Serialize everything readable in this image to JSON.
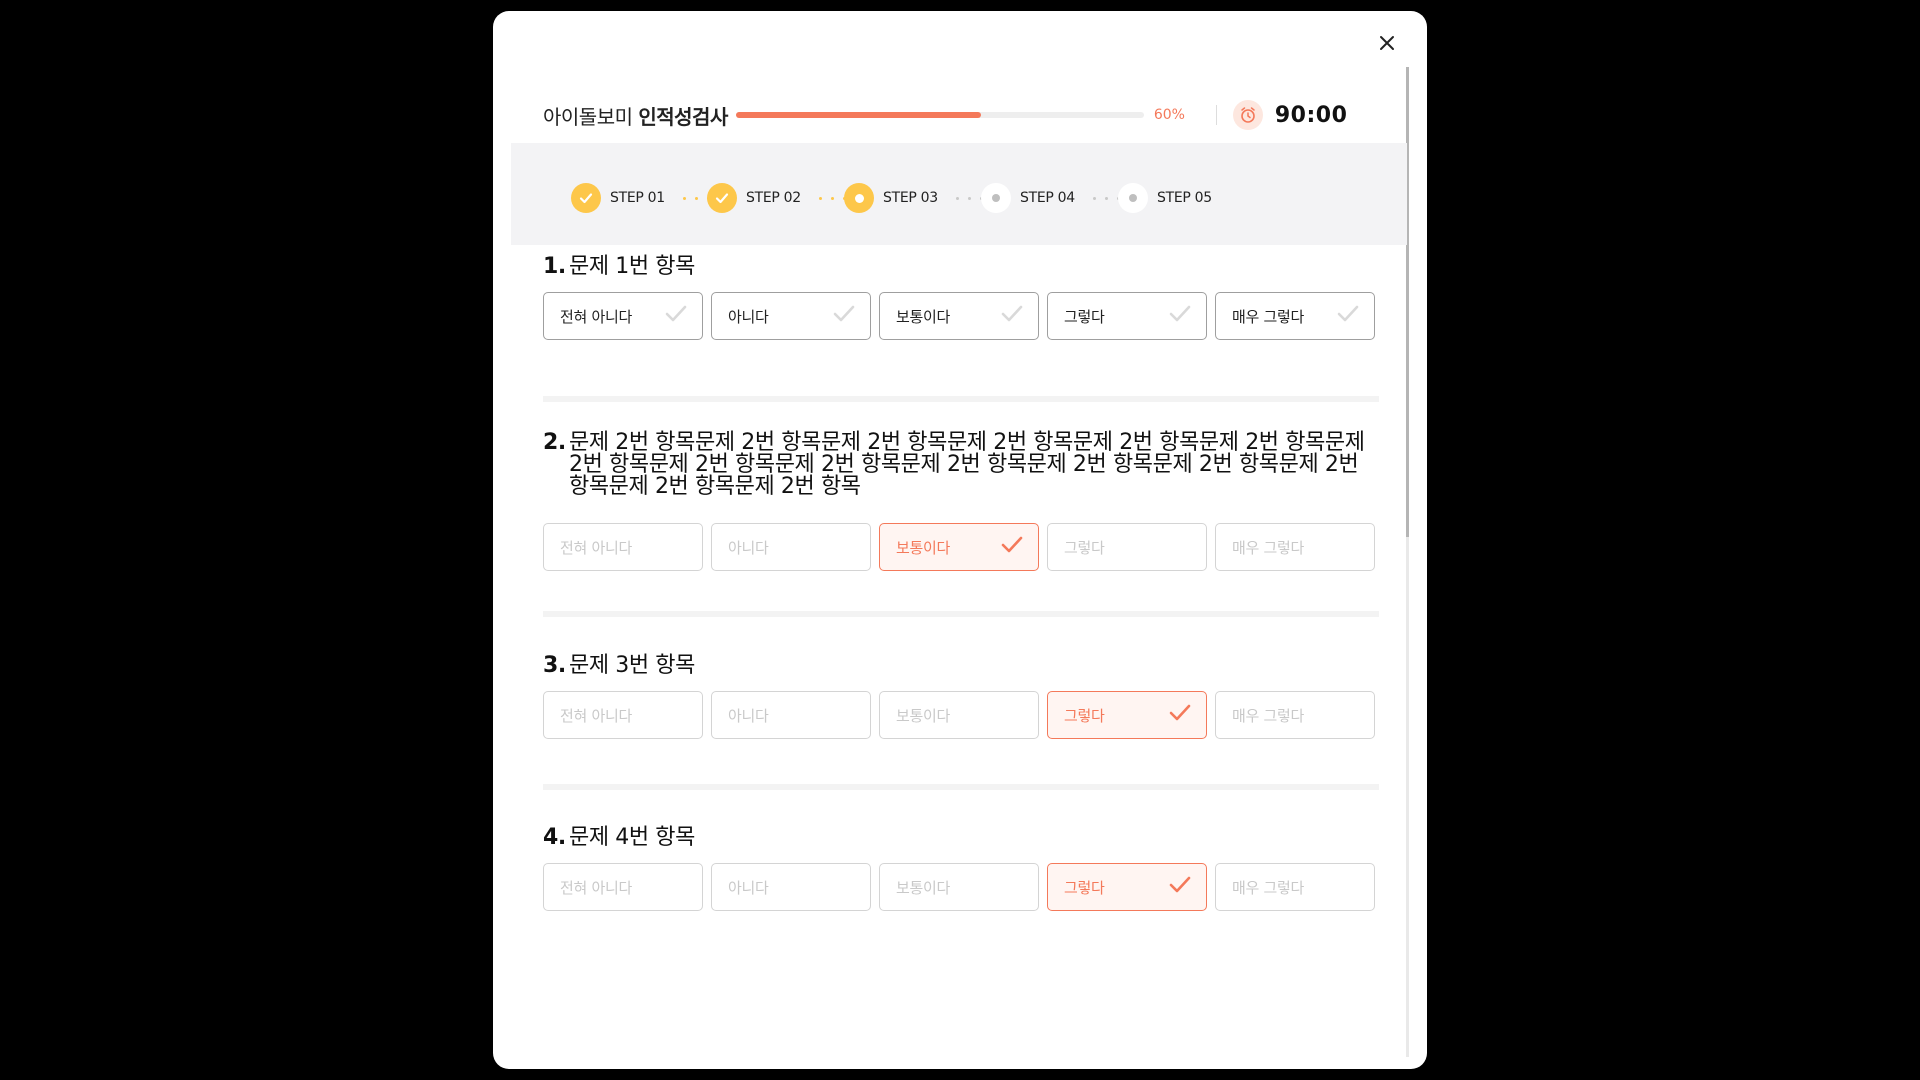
{
  "header": {
    "title_light": "아이돌보미",
    "title_bold": "인적성검사",
    "progress_percent": 60,
    "progress_label": "60%",
    "timer": "90:00"
  },
  "close_icon": "close-icon",
  "timer_icon": "alarm-clock-icon",
  "steps": [
    {
      "label": "STEP 01",
      "state": "done"
    },
    {
      "label": "STEP 02",
      "state": "done"
    },
    {
      "label": "STEP 03",
      "state": "current"
    },
    {
      "label": "STEP 04",
      "state": "todo"
    },
    {
      "label": "STEP 05",
      "state": "todo"
    }
  ],
  "questions": [
    {
      "number": "1.",
      "text": "문제 1번 항목",
      "options": [
        "전혀 아니다",
        "아니다",
        "보통이다",
        "그렇다",
        "매우 그렇다"
      ],
      "selected_index": null
    },
    {
      "number": "2.",
      "text": "문제 2번 항목문제 2번 항목문제 2번 항목문제 2번 항목문제 2번 항목문제 2번 항목문제 2번 항목문제 2번 항목문제 2번 항목문제 2번 항목문제 2번 항목문제 2번 항목문제 2번 항목문제 2번 항목문제 2번 항목",
      "options": [
        "전혀 아니다",
        "아니다",
        "보통이다",
        "그렇다",
        "매우 그렇다"
      ],
      "selected_index": 2
    },
    {
      "number": "3.",
      "text": "문제 3번 항목",
      "options": [
        "전혀 아니다",
        "아니다",
        "보통이다",
        "그렇다",
        "매우 그렇다"
      ],
      "selected_index": 3
    },
    {
      "number": "4.",
      "text": "문제 4번 항목",
      "options": [
        "전혀 아니다",
        "아니다",
        "보통이다",
        "그렇다",
        "매우 그렇다"
      ],
      "selected_index": 3
    }
  ],
  "colors": {
    "accent": "#f4795a",
    "step_yellow": "#fdc74a"
  }
}
